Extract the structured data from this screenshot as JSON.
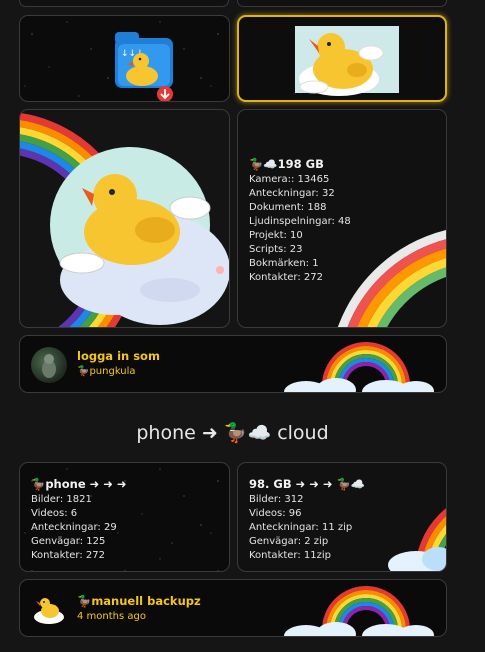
{
  "storage_card": {
    "title": "🦆☁️198 GB",
    "lines": [
      "Kamera:: 13465",
      "Anteckningar: 32",
      "Dokument: 188",
      "Ljudinspelningar: 48",
      "Projekt: 10",
      "Scripts: 23",
      "Bokmärken: 1",
      "Kontakter: 272"
    ]
  },
  "login_card": {
    "label": "logga in som",
    "username": "🦆pungkula"
  },
  "section": {
    "left": "phone",
    "arrow": "➜",
    "icons": "🦆☁️",
    "right": "cloud"
  },
  "phone_card": {
    "title": "🦆phone ➜ ➜ ➜",
    "lines": [
      "Bilder: 1821",
      "Videos: 6",
      "Anteckningar: 29",
      "Genvägar: 125",
      "Kontakter:  272"
    ]
  },
  "cloud_card": {
    "title": "98. GB ➜ ➜ ➜ 🦆☁️",
    "lines": [
      "Bilder: 312",
      "Videos: 96",
      "Anteckningar: 11 zip",
      "Genvägar: 2 zip",
      "Kontakter: 11zip"
    ]
  },
  "backup_card": {
    "label": "🦆manuell backupz",
    "time": "4 months ago"
  },
  "colors": {
    "accent": "#f5c518",
    "selected_border": "#e0b21a",
    "card_border": "#3a3a3a",
    "background": "#151515"
  }
}
